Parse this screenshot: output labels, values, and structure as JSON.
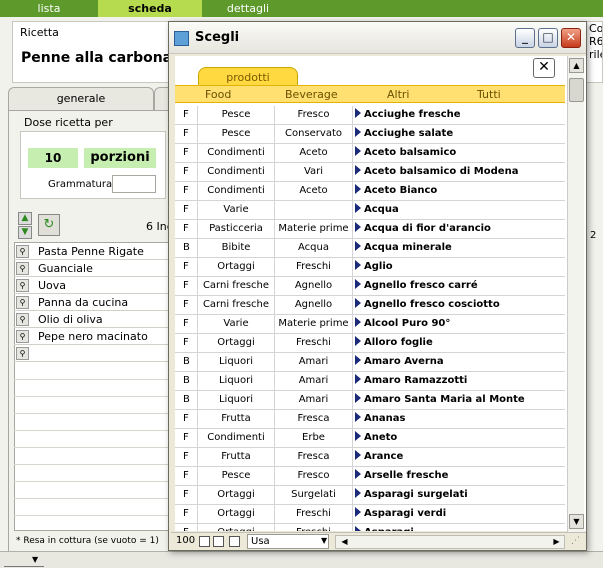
{
  "top_tabs": [
    {
      "label": "lista"
    },
    {
      "label": "scheda"
    },
    {
      "label": "dettagli"
    }
  ],
  "ricetta": {
    "label": "Ricetta",
    "name": "Penne alla carbonara"
  },
  "right_cut": {
    "line1": "Co",
    "line2": "R6",
    "line3": "rile"
  },
  "tab_generale": "generale",
  "dose": {
    "label": "Dose ricetta per",
    "value": "10",
    "unit": "porzioni",
    "grammatura_label": "Grammatura"
  },
  "ingredients": {
    "count": "6 Ing",
    "items": [
      "Pasta Penne Rigate",
      "Guanciale",
      "Uova",
      "Panna da cucina",
      "Olio di oliva",
      "Pepe nero macinato"
    ]
  },
  "resa_note": "* Resa in cottura (se vuoto = 1)",
  "right_col_vals": [
    "2",
    "",
    "",
    "",
    "",
    "",
    ""
  ],
  "dialog": {
    "title": "Scegli",
    "close_x": "✕",
    "tab": "prodotti",
    "categories": [
      "Food",
      "Beverage",
      "Altri",
      "Tutti"
    ],
    "rows": [
      {
        "f": "F",
        "food": "Pesce",
        "bev": "Fresco",
        "name": "Acciughe fresche"
      },
      {
        "f": "F",
        "food": "Pesce",
        "bev": "Conservato",
        "name": "Acciughe salate"
      },
      {
        "f": "F",
        "food": "Condimenti",
        "bev": "Aceto",
        "name": "Aceto balsamico"
      },
      {
        "f": "F",
        "food": "Condimenti",
        "bev": "Vari",
        "name": "Aceto balsamico di Modena"
      },
      {
        "f": "F",
        "food": "Condimenti",
        "bev": "Aceto",
        "name": "Aceto Bianco"
      },
      {
        "f": "F",
        "food": "Varie",
        "bev": "",
        "name": "Acqua"
      },
      {
        "f": "F",
        "food": "Pasticceria",
        "bev": "Materie prime",
        "name": "Acqua di fior d'arancio"
      },
      {
        "f": "B",
        "food": "Bibite",
        "bev": "Acqua",
        "name": "Acqua minerale"
      },
      {
        "f": "F",
        "food": "Ortaggi",
        "bev": "Freschi",
        "name": "Aglio"
      },
      {
        "f": "F",
        "food": "Carni fresche",
        "bev": "Agnello",
        "name": "Agnello fresco carré"
      },
      {
        "f": "F",
        "food": "Carni fresche",
        "bev": "Agnello",
        "name": "Agnello fresco cosciotto"
      },
      {
        "f": "F",
        "food": "Varie",
        "bev": "Materie prime",
        "name": "Alcool Puro 90°"
      },
      {
        "f": "F",
        "food": "Ortaggi",
        "bev": "Freschi",
        "name": "Alloro foglie"
      },
      {
        "f": "B",
        "food": "Liquori",
        "bev": "Amari",
        "name": "Amaro Averna"
      },
      {
        "f": "B",
        "food": "Liquori",
        "bev": "Amari",
        "name": "Amaro Ramazzotti"
      },
      {
        "f": "B",
        "food": "Liquori",
        "bev": "Amari",
        "name": "Amaro Santa Maria al Monte"
      },
      {
        "f": "F",
        "food": "Frutta",
        "bev": "Fresca",
        "name": "Ananas"
      },
      {
        "f": "F",
        "food": "Condimenti",
        "bev": "Erbe",
        "name": "Aneto"
      },
      {
        "f": "F",
        "food": "Frutta",
        "bev": "Fresca",
        "name": "Arance"
      },
      {
        "f": "F",
        "food": "Pesce",
        "bev": "Fresco",
        "name": "Arselle fresche"
      },
      {
        "f": "F",
        "food": "Ortaggi",
        "bev": "Surgelati",
        "name": "Asparagi surgelati"
      },
      {
        "f": "F",
        "food": "Ortaggi",
        "bev": "Freschi",
        "name": "Asparagi verdi"
      },
      {
        "f": "F",
        "food": "Ortaggi",
        "bev": "Freschi",
        "name": "Asparagi ..."
      }
    ],
    "footer": {
      "zoom": "100",
      "select_value": "Usa"
    }
  }
}
